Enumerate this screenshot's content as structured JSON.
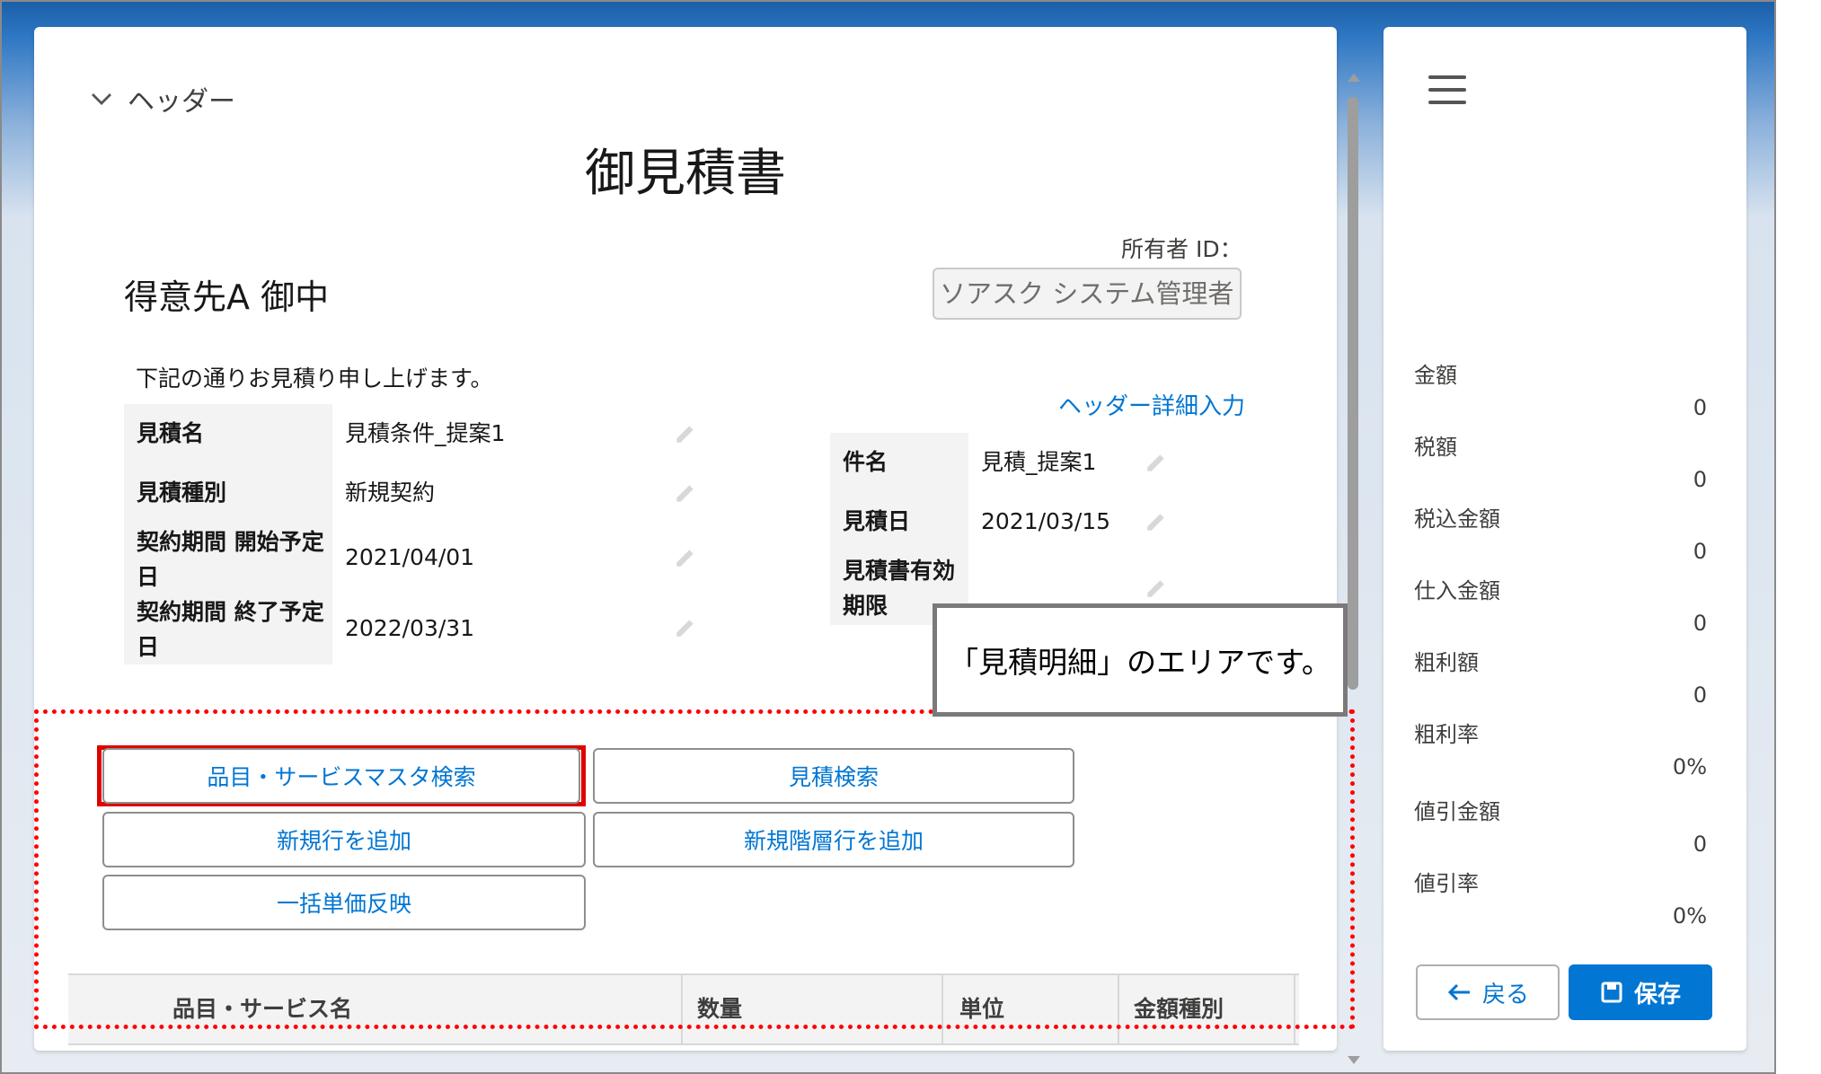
{
  "header_section": {
    "toggle_label": "ヘッダー"
  },
  "document": {
    "title": "御見積書",
    "customer": "得意先A 御中",
    "intro": "下記の通りお見積り申し上げます。"
  },
  "owner": {
    "label": "所有者 ID：",
    "value": "ソアスク システム管理者"
  },
  "header_detail_link": "ヘッダー詳細入力",
  "left_fields": [
    {
      "label": "見積名",
      "value": "見積条件_提案1"
    },
    {
      "label": "見積種別",
      "value": "新規契約"
    },
    {
      "label": "契約期間 開始予定日",
      "value": "2021/04/01"
    },
    {
      "label": "契約期間 終了予定日",
      "value": "2022/03/31"
    }
  ],
  "right_fields": [
    {
      "label": "件名",
      "value": "見積_提案1"
    },
    {
      "label": "見積日",
      "value": "2021/03/15"
    },
    {
      "label": "見積書有効期限",
      "value": ""
    }
  ],
  "callout": "「見積明細」のエリアです。",
  "buttons": {
    "item_master_search": "品目・サービスマスタ検索",
    "quote_search": "見積検索",
    "add_row": "新規行を追加",
    "add_hierarchy_row": "新規階層行を追加",
    "bulk_price": "一括単価反映"
  },
  "table_headers": [
    "品目・サービス名",
    "数量",
    "単位",
    "金額種別"
  ],
  "summary": [
    {
      "label": "金額",
      "value": "0"
    },
    {
      "label": "税額",
      "value": "0"
    },
    {
      "label": "税込金額",
      "value": "0"
    },
    {
      "label": "仕入金額",
      "value": "0"
    },
    {
      "label": "粗利額",
      "value": "0"
    },
    {
      "label": "粗利率",
      "value": "0%"
    },
    {
      "label": "値引金額",
      "value": "0"
    },
    {
      "label": "値引率",
      "value": "0%"
    }
  ],
  "footer": {
    "back_label": "戻る",
    "save_label": "保存"
  },
  "colors": {
    "brand_blue": "#0176d3",
    "highlight_red": "#e00000"
  },
  "icons": [
    "chevron-down-icon",
    "pencil-icon",
    "hamburger-menu-icon",
    "arrow-left-icon",
    "save-disk-icon"
  ]
}
